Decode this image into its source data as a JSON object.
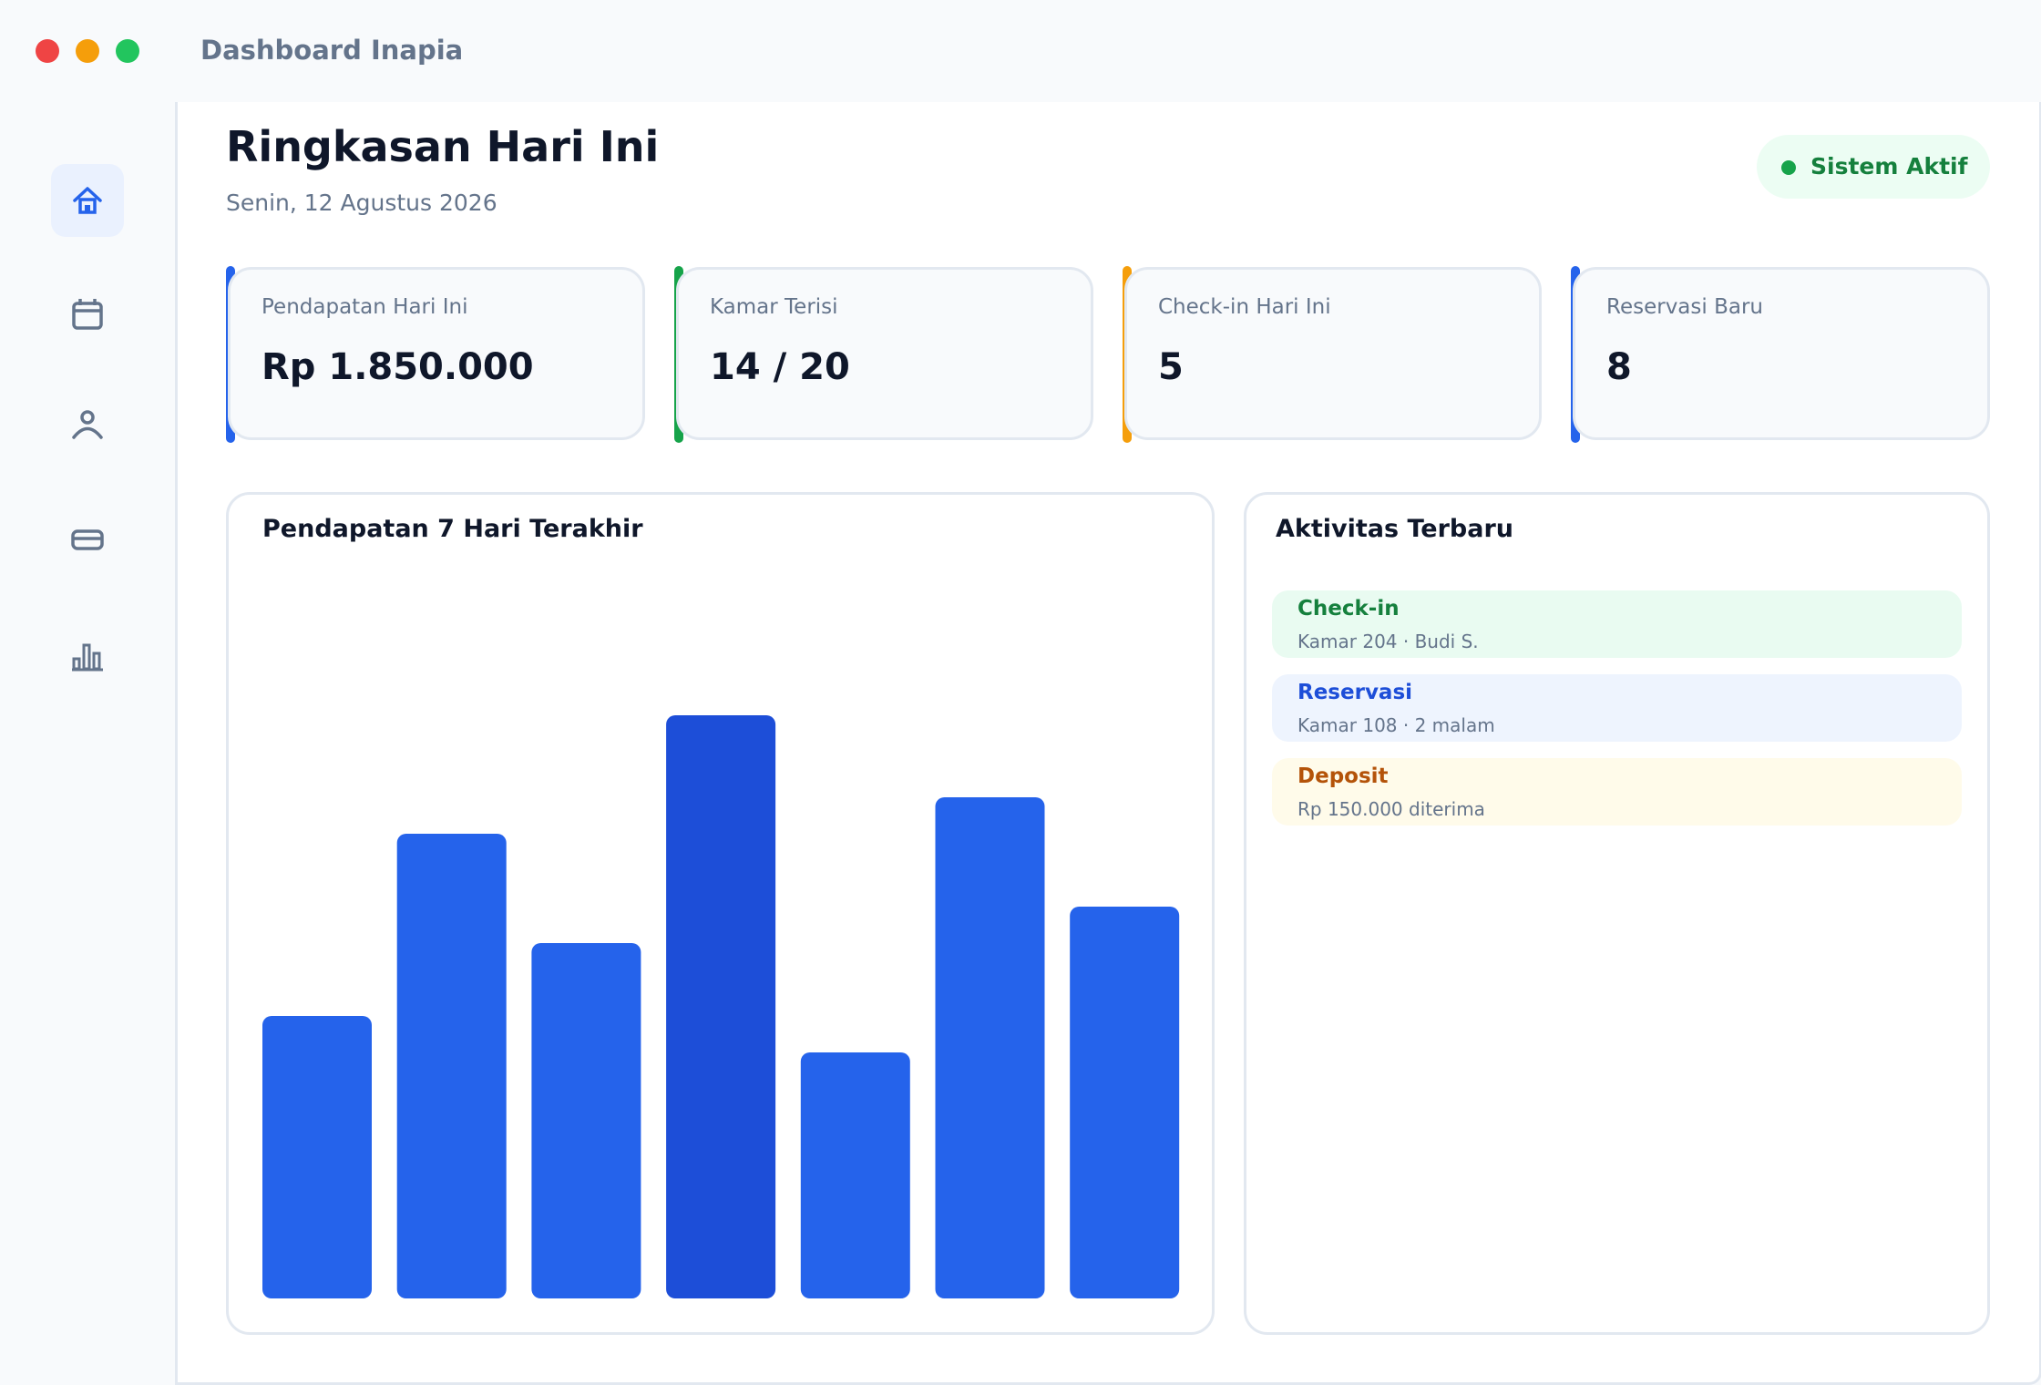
{
  "window": {
    "title": "Dashboard Inapia",
    "controls": {
      "close_color": "#ef4444",
      "minimize_color": "#f59e0b",
      "maximize_color": "#22c55e"
    }
  },
  "sidebar": {
    "items": [
      {
        "icon": "home-icon",
        "active": true
      },
      {
        "icon": "calendar-icon",
        "active": false
      },
      {
        "icon": "user-icon",
        "active": false
      },
      {
        "icon": "credit-card-icon",
        "active": false
      },
      {
        "icon": "bar-chart-icon",
        "active": false
      }
    ]
  },
  "header": {
    "title": "Ringkasan Hari Ini",
    "date": "Senin, 12 Agustus 2026",
    "status": "Sistem Aktif"
  },
  "stats": [
    {
      "label": "Pendapatan Hari Ini",
      "value": "Rp 1.850.000",
      "accent": "#2563eb"
    },
    {
      "label": "Kamar Terisi",
      "value": "14 / 20",
      "accent": "#16a34a"
    },
    {
      "label": "Check-in Hari Ini",
      "value": "5",
      "accent": "#f59e0b"
    },
    {
      "label": "Reservasi Baru",
      "value": "8",
      "accent": "#2563eb"
    }
  ],
  "revenue_panel": {
    "title": "Pendapatan 7 Hari Terakhir"
  },
  "chart_data": {
    "type": "bar",
    "title": "Pendapatan 7 Hari Terakhir",
    "categories": [
      "",
      "",
      "",
      "",
      "",
      "",
      ""
    ],
    "values": [
      31,
      51,
      39,
      64,
      27,
      55,
      43
    ],
    "highlight_index": 3,
    "ylim": [
      0,
      100
    ],
    "grid": false,
    "colors": {
      "bar": "#2563eb",
      "highlight": "#1d4ed8"
    }
  },
  "activity_panel": {
    "title": "Aktivitas Terbaru",
    "items": [
      {
        "title": "Check-in",
        "subtitle": "Kamar 204 · Budi S.",
        "title_color": "#15803d",
        "bg": "#e9fbf1"
      },
      {
        "title": "Reservasi",
        "subtitle": "Kamar 108 · 2 malam",
        "title_color": "#1d4ed8",
        "bg": "#eef4fe"
      },
      {
        "title": "Deposit",
        "subtitle": "Rp 150.000 diterima",
        "title_color": "#b45309",
        "bg": "#fffbea"
      }
    ]
  }
}
